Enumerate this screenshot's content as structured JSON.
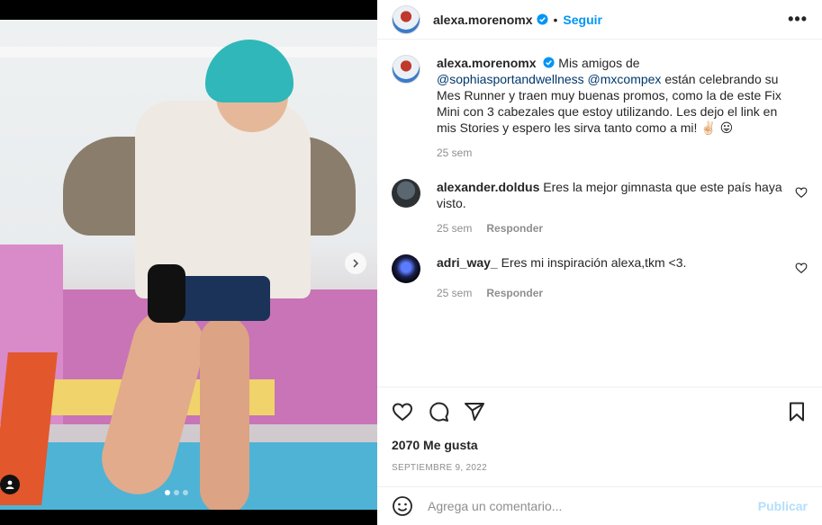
{
  "header": {
    "username": "alexa.morenomx",
    "separator": "•",
    "follow_label": "Seguir",
    "more_icon": "more-horizontal-icon"
  },
  "caption": {
    "username": "alexa.morenomx",
    "text_1": "Mis amigos de ",
    "mention_1": "@sophiasportandwellness",
    "text_2": " ",
    "mention_2": "@mxcompex",
    "text_3": " están celebrando su Mes Runner y traen muy buenas promos, como la de este Fix Mini con 3 cabezales que estoy utilizando. Les dejo el link en mis Stories y espero les sirva tanto como a mi! ✌🏻 😛",
    "time": "25 sem"
  },
  "comments": [
    {
      "username": "alexander.doldus",
      "text": "Eres la mejor gimnasta que este país haya visto.",
      "time": "25 sem",
      "reply_label": "Responder"
    },
    {
      "username": "adri_way_",
      "text": "Eres mi inspiración alexa,tkm  <3.",
      "time": "25 sem",
      "reply_label": "Responder"
    }
  ],
  "actions": {
    "likes": "2070 Me gusta",
    "date": "SEPTIEMBRE 9, 2022"
  },
  "add_comment": {
    "placeholder": "Agrega un comentario...",
    "post_label": "Publicar"
  },
  "carousel": {
    "slide_count": 3,
    "active_index": 0
  },
  "colors": {
    "accent": "#0095f6",
    "mention": "#00376b",
    "muted": "#8e8e8e",
    "post_disabled": "#b2dffc"
  }
}
